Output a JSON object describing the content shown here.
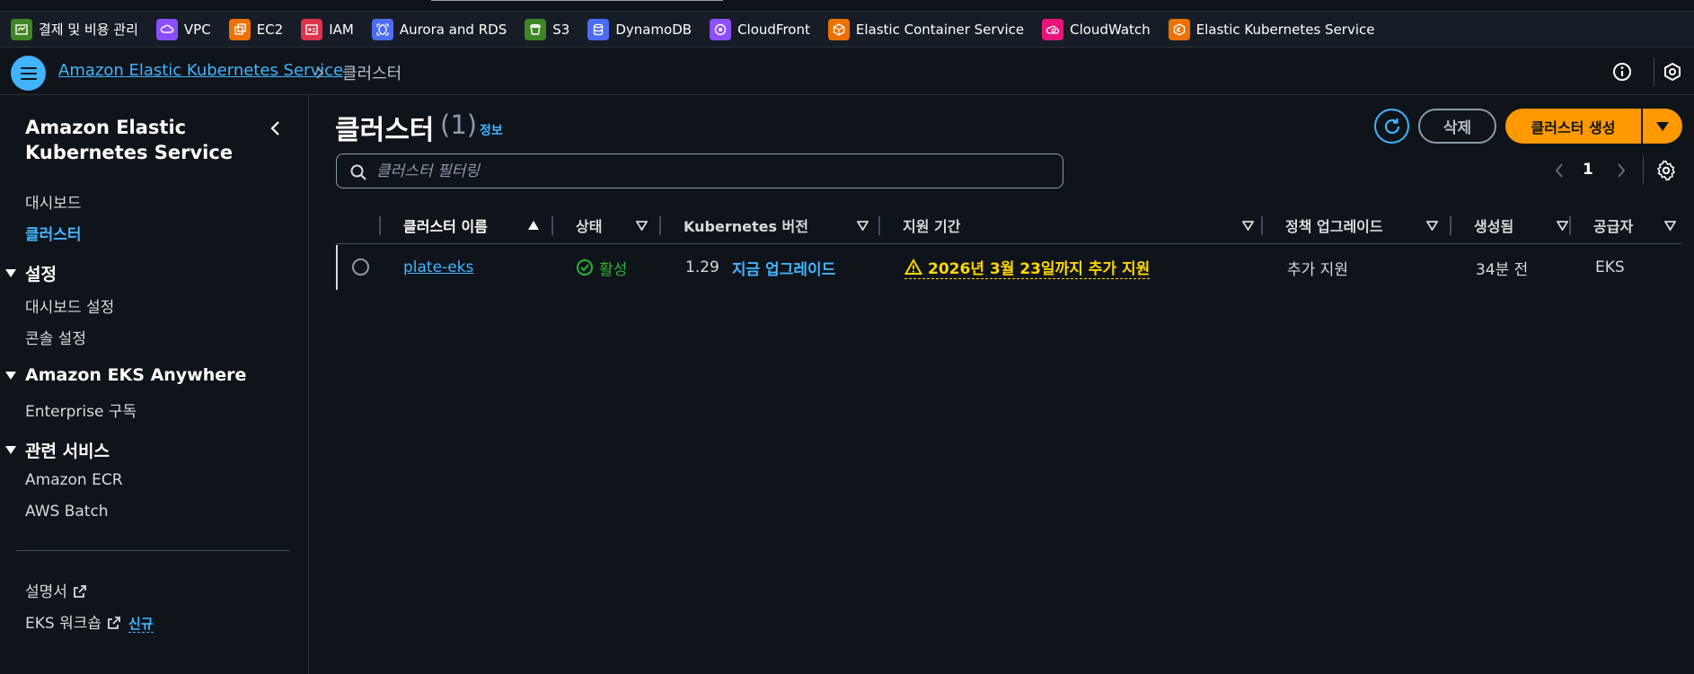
{
  "favorites": [
    {
      "label": "결제 및 비용 관리",
      "icon": "billing-icon",
      "color": "#3f8624"
    },
    {
      "label": "VPC",
      "icon": "vpc-icon",
      "color": "#8c4fff"
    },
    {
      "label": "EC2",
      "icon": "ec2-icon",
      "color": "#ed7100"
    },
    {
      "label": "IAM",
      "icon": "iam-icon",
      "color": "#dd344c"
    },
    {
      "label": "Aurora and RDS",
      "icon": "rds-icon",
      "color": "#4d6cf5"
    },
    {
      "label": "S3",
      "icon": "s3-icon",
      "color": "#3f8624"
    },
    {
      "label": "DynamoDB",
      "icon": "dynamodb-icon",
      "color": "#4d6cf5"
    },
    {
      "label": "CloudFront",
      "icon": "cloudfront-icon",
      "color": "#8c4fff"
    },
    {
      "label": "Elastic Container Service",
      "icon": "ecs-icon",
      "color": "#ed7100"
    },
    {
      "label": "CloudWatch",
      "icon": "cloudwatch-icon",
      "color": "#e7157b"
    },
    {
      "label": "Elastic Kubernetes Service",
      "icon": "eks-icon",
      "color": "#ed7100"
    }
  ],
  "breadcrumb": {
    "root": "Amazon Elastic Kubernetes Service",
    "current": "클러스터"
  },
  "sidebar": {
    "title": "Amazon Elastic Kubernetes Service",
    "links": {
      "dashboard": "대시보드",
      "clusters": "클러스터"
    },
    "sections": [
      {
        "title": "설정",
        "items": [
          "대시보드 설정",
          "콘솔 설정"
        ]
      },
      {
        "title": "Amazon EKS Anywhere",
        "items": [
          "Enterprise 구독"
        ]
      },
      {
        "title": "관련 서비스",
        "items": [
          "Amazon ECR",
          "AWS Batch"
        ]
      }
    ],
    "footer": {
      "docs": "설명서",
      "workshop": "EKS 워크숍",
      "new_badge": "신규"
    }
  },
  "main": {
    "title": "클러스터",
    "count": "(1)",
    "info": "정보",
    "delete_label": "삭제",
    "create_label": "클러스터 생성",
    "filter_placeholder": "클러스터 필터링",
    "page": "1"
  },
  "table": {
    "columns": [
      "클러스터 이름",
      "상태",
      "Kubernetes 버전",
      "지원 기간",
      "정책 업그레이드",
      "생성됨",
      "공급자"
    ],
    "rows": [
      {
        "name": "plate-eks",
        "status": "활성",
        "version": "1.29",
        "upgrade": "지금 업그레이드",
        "support": "2026년 3월 23일까지 추가 지원",
        "policy": "추가 지원",
        "created": "34분 전",
        "provider": "EKS"
      }
    ]
  },
  "colors": {
    "accent": "#42b4ff",
    "primary": "#ff9900",
    "success": "#2bb534",
    "warning": "#ffd700",
    "background": "#0f141a"
  }
}
